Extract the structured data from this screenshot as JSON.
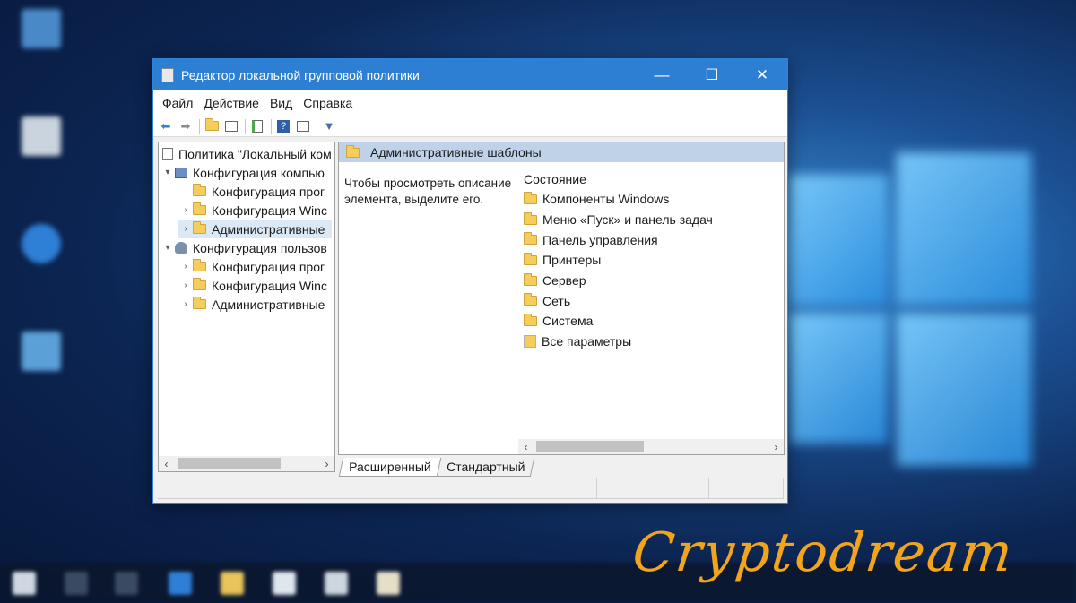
{
  "window": {
    "title": "Редактор локальной групповой политики",
    "controls": {
      "minimize": "—",
      "maximize": "☐",
      "close": "✕"
    }
  },
  "menu": [
    "Файл",
    "Действие",
    "Вид",
    "Справка"
  ],
  "toolbar": {
    "icons": [
      "back-arrow-icon",
      "forward-arrow-icon",
      "up-folder-icon",
      "show-hide-tree-icon",
      "export-list-icon",
      "help-icon",
      "properties-icon",
      "filter-icon"
    ]
  },
  "tree": {
    "root": "Политика \"Локальный ком",
    "computer": "Конфигурация компью",
    "computer_children": [
      "Конфигурация прог",
      "Конфигурация Winc",
      "Административные"
    ],
    "user": "Конфигурация пользов",
    "user_children": [
      "Конфигурация прог",
      "Конфигурация Winc",
      "Административные"
    ]
  },
  "right_pane": {
    "header": "Административные шаблоны",
    "description": "Чтобы просмотреть описание элемента, выделите его.",
    "column_header": "Состояние",
    "items": [
      "Компоненты Windows",
      "Меню «Пуск» и панель задач",
      "Панель управления",
      "Принтеры",
      "Сервер",
      "Сеть",
      "Система",
      "Все параметры"
    ]
  },
  "tabs": [
    "Расширенный",
    "Стандартный"
  ],
  "watermark": "Cryptodream",
  "colors": {
    "titlebar": "#2d7fd3",
    "selection": "#dbe8f6",
    "header": "#bfd2e8",
    "watermark": "#f2a41c"
  }
}
